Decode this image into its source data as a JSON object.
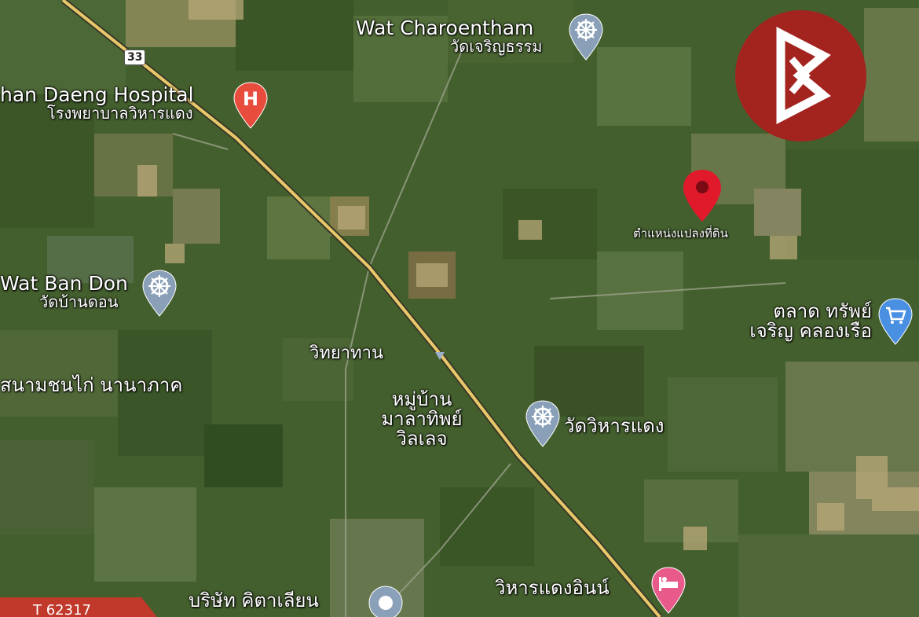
{
  "map": {
    "type": "satellite",
    "road_number": "33",
    "places": {
      "wat_charoentham": {
        "en": "Wat Charoentham",
        "th": "วัดเจริญธรรม",
        "icon": "temple-icon"
      },
      "hospital": {
        "en": "han Daeng Hospital",
        "th": "โรงพยาบาลวิหารแดง",
        "icon": "hospital-icon"
      },
      "wat_ban_don": {
        "en": "Wat Ban Don",
        "th": "วัดบ้านดอน",
        "icon": "temple-icon"
      },
      "land_plot": {
        "th": "ตำแหน่งแปลงที่ดิน",
        "icon": "location-pin-icon",
        "pin_color": "#e0192b"
      },
      "market": {
        "th_line1": "ตลาด ทรัพย์",
        "th_line2": "เจริญ คลองเรือ",
        "icon": "shopping-cart-icon"
      },
      "partial_road": {
        "th": "วิทยาทาน"
      },
      "cockfight": {
        "th": "สนามชนไก่ นานาภาค"
      },
      "village": {
        "line1": "หมู่บ้าน",
        "line2": "มาลาทิพย์",
        "line3": "วิลเลจ"
      },
      "wat_wihan_daeng": {
        "th": "วัดวิหารแดง",
        "icon": "temple-icon"
      },
      "inn": {
        "th": "วิหารแดงอินน์",
        "icon": "hotel-icon"
      },
      "company": {
        "th": "บริษัท คิตาเลียน",
        "icon": "poi-icon"
      }
    }
  },
  "brand": {
    "logo_icon": "brand-logo-icon",
    "color": "#a3231f"
  },
  "listing": {
    "id": "T 62317",
    "tag_color": "#c0392b"
  },
  "colors": {
    "pin_red": "#e0192b",
    "poi_gray": "#8aa0b8",
    "hospital": "#e74c3c",
    "market_blue": "#4a90e2",
    "road": "#e8c86a"
  }
}
